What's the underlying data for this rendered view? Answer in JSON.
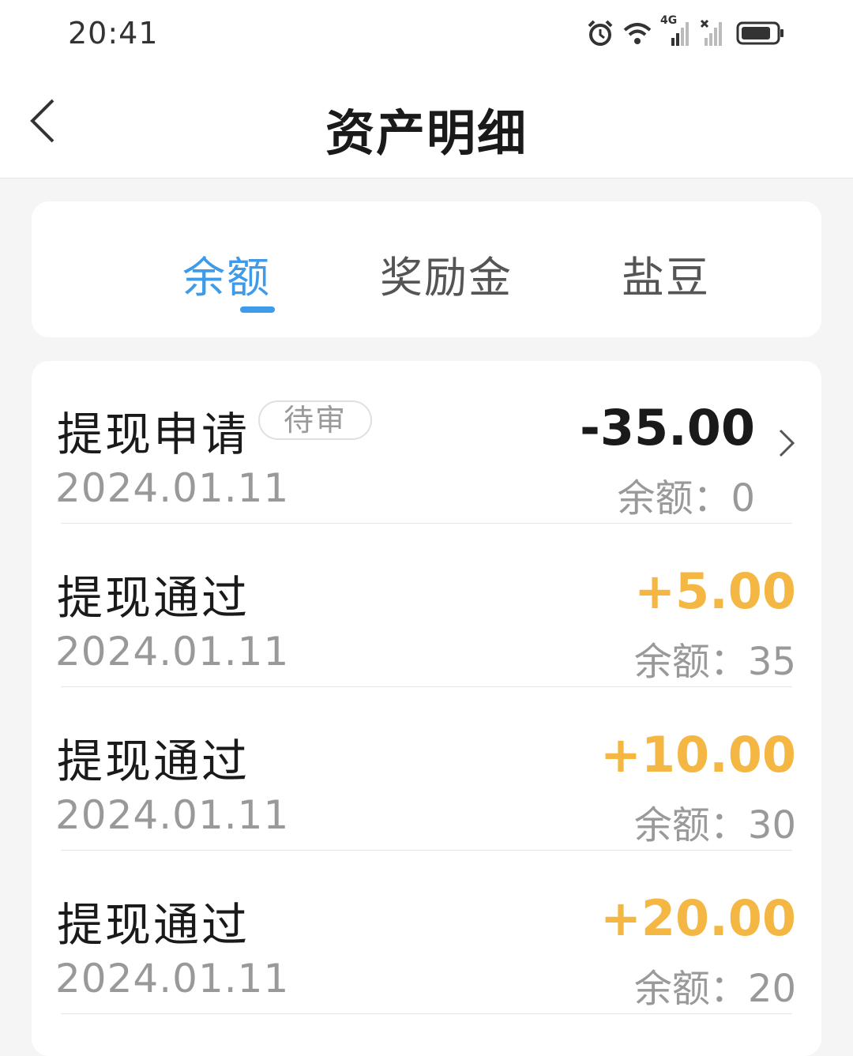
{
  "status_bar": {
    "time": "20:41",
    "icons": [
      "alarm-icon",
      "wifi-icon",
      "signal-4g-icon",
      "signal-no-sim-icon",
      "battery-icon"
    ],
    "network_label": "4G"
  },
  "header": {
    "title": "资产明细",
    "back_icon": "chevron-left-icon"
  },
  "tabs": [
    {
      "label": "余额",
      "active": true
    },
    {
      "label": "奖励金",
      "active": false
    },
    {
      "label": "盐豆",
      "active": false
    }
  ],
  "colors": {
    "accent": "#3d9be9",
    "positive_amount": "#f5b744",
    "negative_amount": "#1a1a1a",
    "muted_text": "#999999"
  },
  "transactions": [
    {
      "title": "提现申请",
      "badge": "待审",
      "date": "2024.01.11",
      "amount": "-35.00",
      "balance": "余额：0",
      "has_chevron": true
    },
    {
      "title": "提现通过",
      "date": "2024.01.11",
      "amount": "+5.00",
      "balance": "余额：35"
    },
    {
      "title": "提现通过",
      "date": "2024.01.11",
      "amount": "+10.00",
      "balance": "余额：30"
    },
    {
      "title": "提现通过",
      "date": "2024.01.11",
      "amount": "+20.00",
      "balance": "余额：20"
    }
  ]
}
